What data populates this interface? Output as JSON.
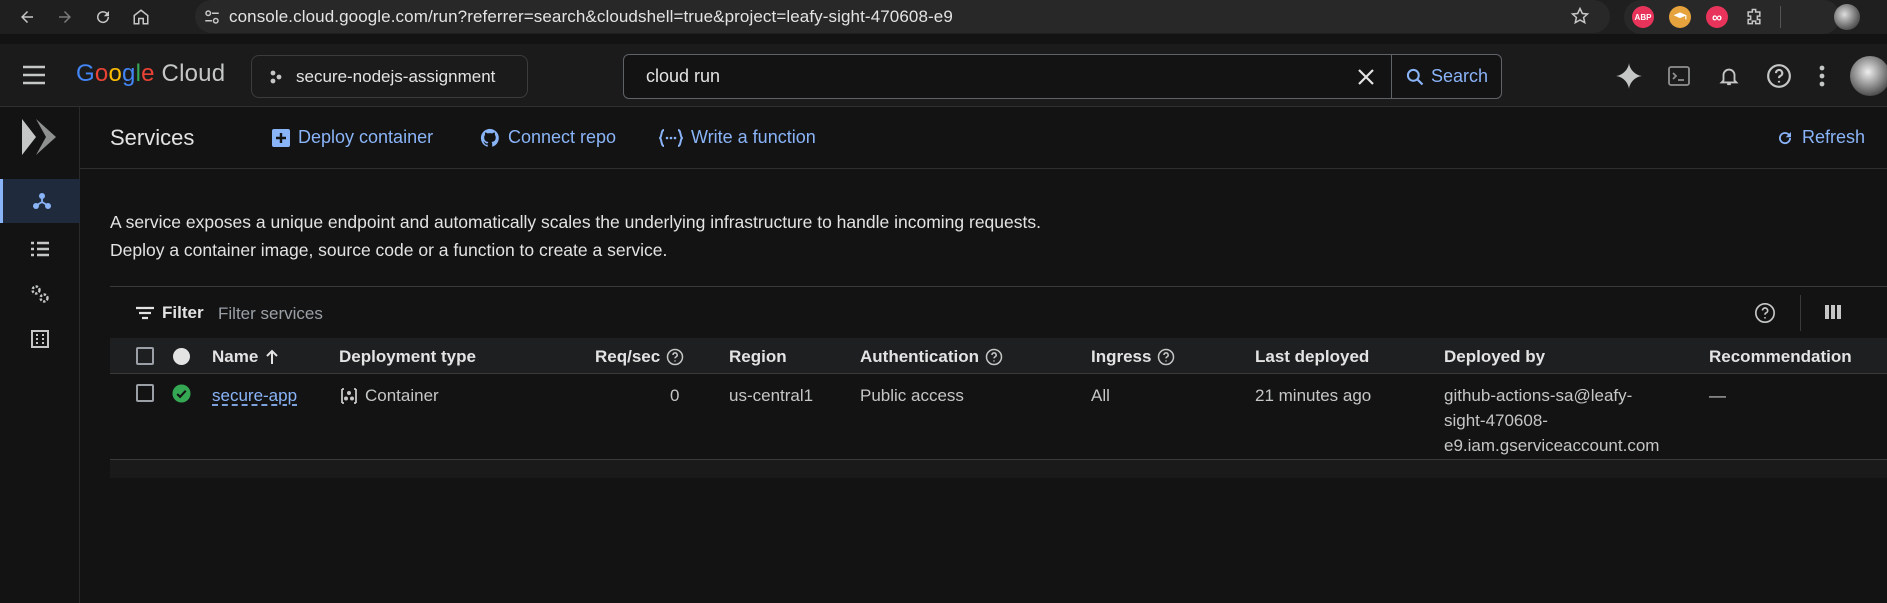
{
  "browser": {
    "url": "console.cloud.google.com/run?referrer=search&cloudshell=true&project=leafy-sight-470608-e9",
    "extensions": [
      {
        "name": "abp-extension-icon",
        "label": "ABP",
        "color": "#e8345a"
      },
      {
        "name": "graduation-cap-extension-icon",
        "label": "",
        "color": "#e6a23c"
      },
      {
        "name": "infinity-extension-icon",
        "label": "∞",
        "color": "#e8345a"
      }
    ]
  },
  "header": {
    "logo_google": "Google",
    "logo_cloud": "Cloud",
    "project": "secure-nodejs-assignment",
    "search_value": "cloud run",
    "search_button": "Search"
  },
  "toolbar": {
    "title": "Services",
    "deploy_container": "Deploy container",
    "connect_repo": "Connect repo",
    "write_function": "Write a function",
    "refresh": "Refresh"
  },
  "description": {
    "line1": "A service exposes a unique endpoint and automatically scales the underlying infrastructure to handle incoming requests.",
    "line2": "Deploy a container image, source code or a function to create a service."
  },
  "filter": {
    "label": "Filter",
    "placeholder": "Filter services"
  },
  "table": {
    "headers": {
      "name": "Name",
      "deployment_type": "Deployment type",
      "req_sec": "Req/sec",
      "region": "Region",
      "authentication": "Authentication",
      "ingress": "Ingress",
      "last_deployed": "Last deployed",
      "deployed_by": "Deployed by",
      "recommendation": "Recommendation"
    },
    "rows": [
      {
        "status": "ok",
        "name": "secure-app",
        "deployment_type": "Container",
        "req_sec": "0",
        "region": "us-central1",
        "authentication": "Public access",
        "ingress": "All",
        "last_deployed": "21 minutes ago",
        "deployed_by_1": "github-actions-sa@leafy-",
        "deployed_by_2": "sight-470608-",
        "deployed_by_3": "e9.iam.gserviceaccount.com",
        "recommendation": "—"
      }
    ]
  },
  "colors": {
    "accent": "#8ab4f8",
    "success": "#34a853"
  }
}
